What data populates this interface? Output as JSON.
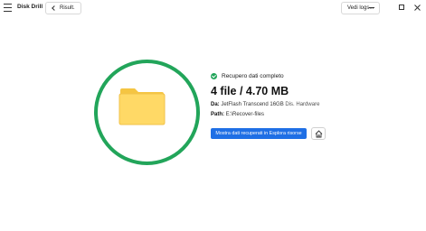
{
  "app": {
    "title": "Disk Drill"
  },
  "toolbar": {
    "back_label": "Risult.",
    "logs_label": "Vedi logs..."
  },
  "icons": {
    "menu": "hamburger-icon",
    "back": "chevron-left-icon",
    "folder": "folder-icon",
    "check": "check-circle-icon",
    "home": "home-icon",
    "minimize": "minimize-icon",
    "maximize": "maximize-icon",
    "close": "close-icon"
  },
  "result": {
    "status": "Recupero dati completo",
    "summary": "4 file / 4.70 MB",
    "device_label": "Da:",
    "device_value": "JetFlash Transcend 16GB",
    "device_extra": "Dis. Hardware",
    "path_label": "Path:",
    "path_value": "E:\\Recover-files",
    "primary_action": "Mostra dati recuperati in Esplora risorse"
  },
  "colors": {
    "success": "#22a55a",
    "primary": "#1f6fe5",
    "folder": "#ffd966"
  }
}
